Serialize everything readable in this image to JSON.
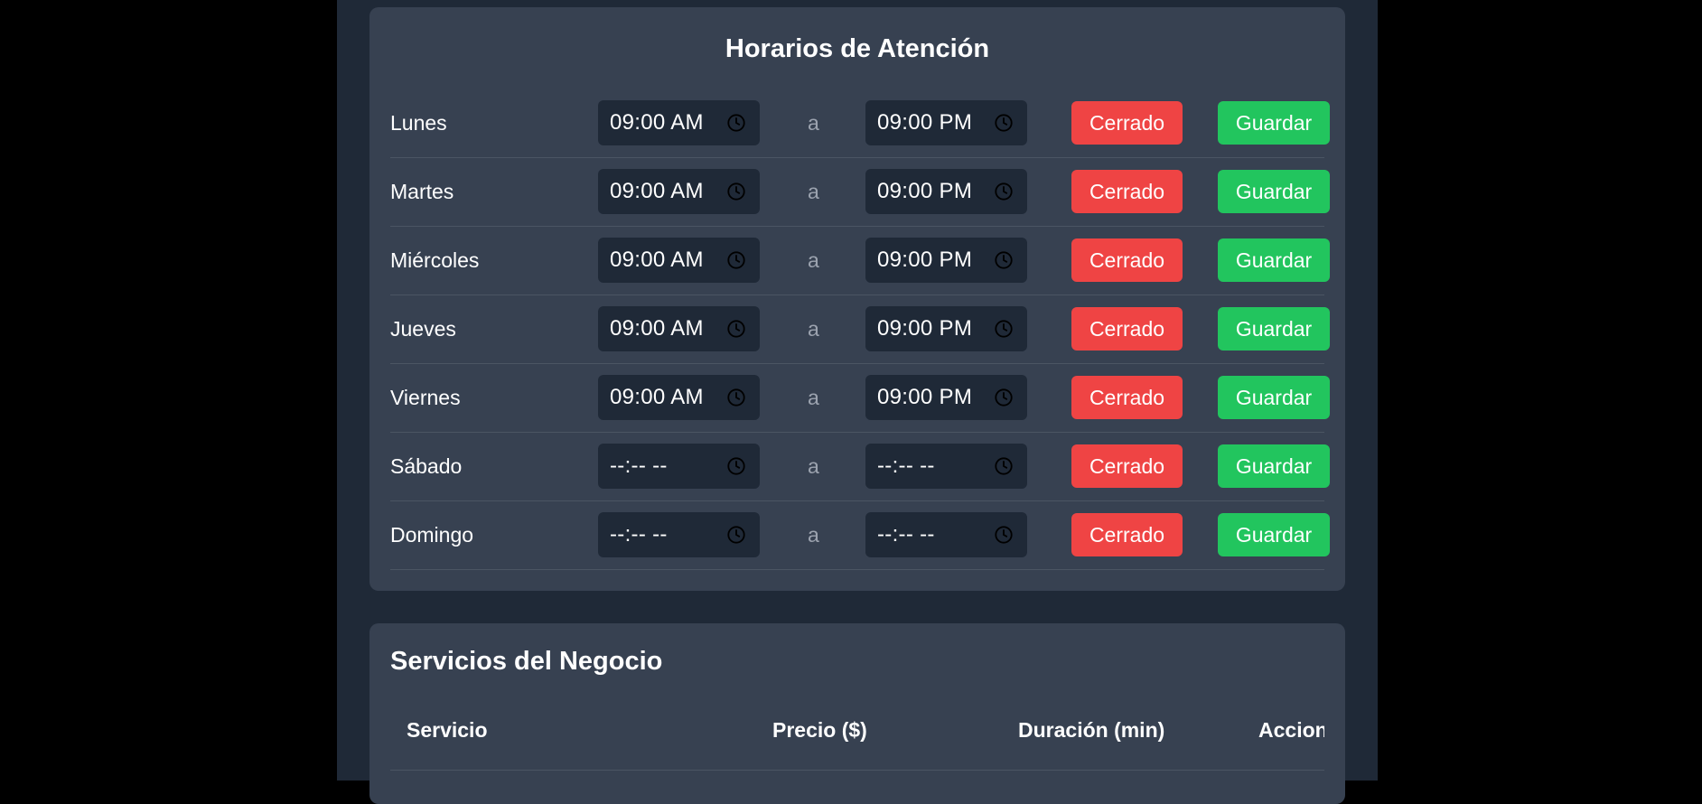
{
  "hours": {
    "title": "Horarios de Atención",
    "separator": "a",
    "closed_label": "Cerrado",
    "save_label": "Guardar",
    "days": [
      {
        "day": "Lunes",
        "from": "09:00  AM",
        "to": "09:00  PM"
      },
      {
        "day": "Martes",
        "from": "09:00  AM",
        "to": "09:00  PM"
      },
      {
        "day": "Miércoles",
        "from": "09:00  AM",
        "to": "09:00  PM"
      },
      {
        "day": "Jueves",
        "from": "09:00  AM",
        "to": "09:00  PM"
      },
      {
        "day": "Viernes",
        "from": "09:00  AM",
        "to": "09:00  PM"
      },
      {
        "day": "Sábado",
        "from": "--:-- --",
        "to": "--:-- --"
      },
      {
        "day": "Domingo",
        "from": "--:-- --",
        "to": "--:-- --"
      }
    ]
  },
  "services": {
    "title": "Servicios del Negocio",
    "columns": [
      "Servicio",
      "Precio ($)",
      "Duración (min)",
      "Acciones"
    ]
  },
  "colors": {
    "page_bg": "#000000",
    "column_bg": "#1f2937",
    "card_bg": "#374151",
    "input_bg": "#1f2937",
    "closed": "#ef4444",
    "save": "#22c55e"
  },
  "icons": {
    "time_input": "clock-icon"
  }
}
